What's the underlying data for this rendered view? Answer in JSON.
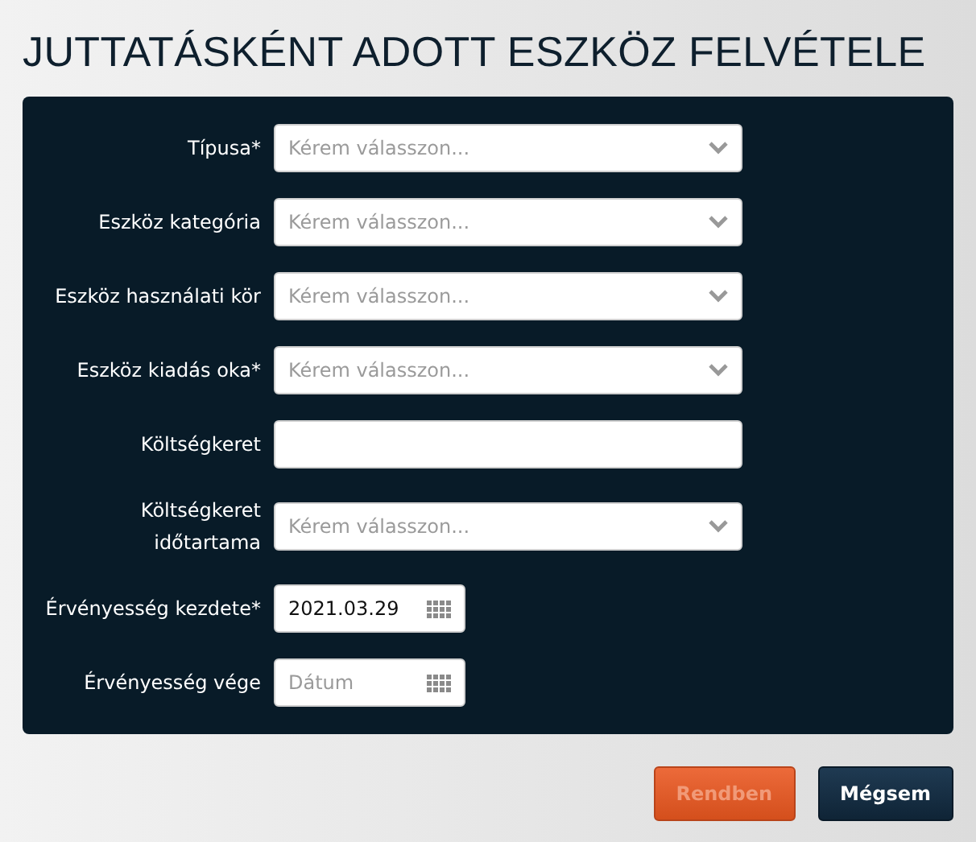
{
  "title": "JUTTATÁSKÉNT ADOTT ESZKÖZ FELVÉTELE",
  "fields": [
    {
      "kind": "select",
      "label": "Típusa*",
      "placeholder": "Kérem válasszon..."
    },
    {
      "kind": "select",
      "label": "Eszköz kategória",
      "placeholder": "Kérem válasszon..."
    },
    {
      "kind": "select",
      "label": "Eszköz használati kör",
      "placeholder": "Kérem válasszon..."
    },
    {
      "kind": "select",
      "label": "Eszköz kiadás oka*",
      "placeholder": "Kérem válasszon..."
    },
    {
      "kind": "text",
      "label": "Költségkeret"
    },
    {
      "kind": "select",
      "label": "Költségkeret időtartama",
      "placeholder": "Kérem válasszon..."
    },
    {
      "kind": "date",
      "label": "Érvényesség kezdete*",
      "value": "2021.03.29"
    },
    {
      "kind": "date",
      "label": "Érvényesség vége",
      "placeholder": "Dátum"
    }
  ],
  "buttons": [
    {
      "kind": "primary",
      "label": "Rendben",
      "disabled": true
    },
    {
      "kind": "secondary",
      "label": "Mégsem",
      "disabled": false
    }
  ]
}
